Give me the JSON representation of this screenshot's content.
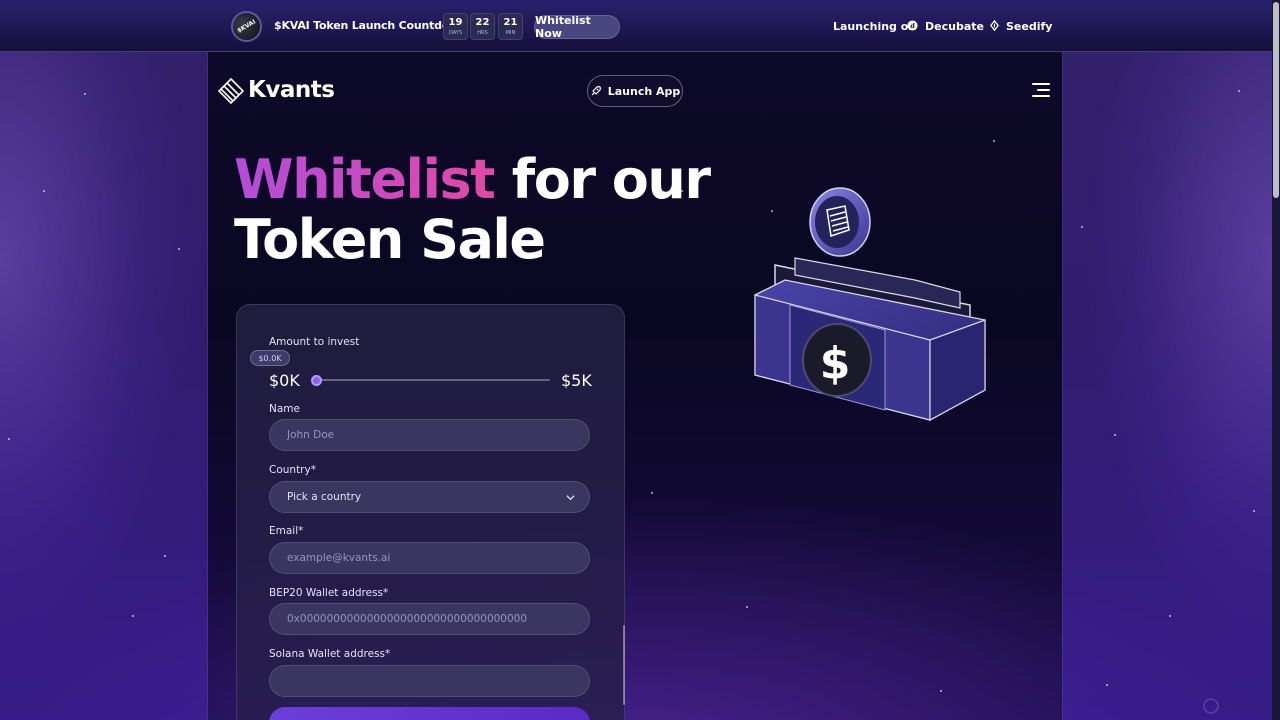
{
  "topbar": {
    "badge_text": "$KVAI",
    "title": "$KVAI Token Launch Countdown",
    "countdown": [
      {
        "value": "19",
        "unit": "DAYS"
      },
      {
        "value": "22",
        "unit": "HRS"
      },
      {
        "value": "21",
        "unit": "MIN"
      }
    ],
    "whitelist_button": "Whitelist Now",
    "launching_label": "Launching on",
    "partners": [
      "Decubate",
      "Seedify"
    ]
  },
  "header": {
    "logo_text": "Kvants",
    "launch_app_label": "Launch App"
  },
  "hero": {
    "accent_word": "Whitelist",
    "line1_rest": "for our",
    "line2": "Token Sale"
  },
  "form": {
    "amount_label": "Amount to invest",
    "slider_tooltip": "$0.0K",
    "slider_min": "$0K",
    "slider_max": "$5K",
    "slider_value_fraction": 0,
    "name_label": "Name",
    "name_placeholder": "John Doe",
    "country_label": "Country*",
    "country_value": "Pick a country",
    "email_label": "Email*",
    "email_placeholder": "example@kvants.ai",
    "bep20_label": "BEP20 Wallet address*",
    "bep20_placeholder": "0x0000000000000000000000000000000000",
    "solana_label": "Solana Wallet address*",
    "solana_placeholder": ""
  },
  "colors": {
    "accent_gradient_start": "#b24cd9",
    "accent_gradient_end": "#e04aa8",
    "slider_thumb": "#8f5cf0",
    "field_bg": "#3a3660"
  }
}
